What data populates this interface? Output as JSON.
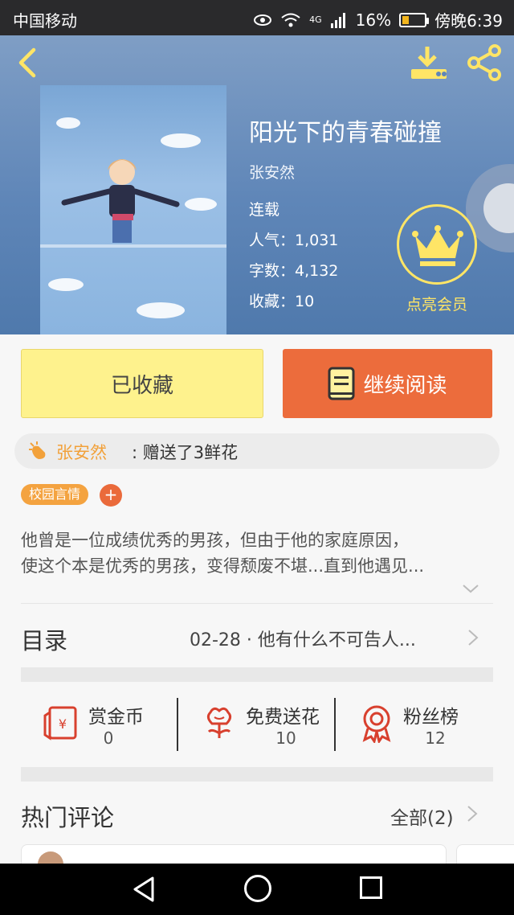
{
  "status_bar": {
    "carrier": "中国移动",
    "battery": "16%",
    "time": "傍晚6:39",
    "network": "4G"
  },
  "book": {
    "title": "阳光下的青春碰撞",
    "author": "张安然",
    "status": "连载",
    "popularity": "人气：1,031",
    "word_count": "字数：4,132",
    "favorites": "收藏：10"
  },
  "vip": {
    "label": "点亮会员"
  },
  "actions": {
    "favorited_label": "已收藏",
    "continue_label": "继续阅读"
  },
  "gift": {
    "name": "张安然",
    "text": ": 赠送了3鲜花"
  },
  "tags": [
    "校园言情"
  ],
  "tag_add": "+",
  "description": {
    "line1": "他曾是一位成绩优秀的男孩，但由于他的家庭原因，",
    "line2": "使这个本是优秀的男孩，变得颓废不堪...直到他遇见..."
  },
  "catalog": {
    "label": "目录",
    "latest": "02-28 · 他有什么不可告人..."
  },
  "stats": [
    {
      "name": "赏金币",
      "value": "0",
      "icon": "red-envelope-icon"
    },
    {
      "name": "免费送花",
      "value": "10",
      "icon": "flower-icon"
    },
    {
      "name": "粉丝榜",
      "value": "12",
      "icon": "medal-icon"
    }
  ],
  "comments": {
    "title": "热门评论",
    "all_label": "全部(2)"
  },
  "colors": {
    "accent_yellow": "#fef28d",
    "accent_orange": "#ec6c3c",
    "tag_orange": "#f4a340",
    "vip_yellow": "#ffe566",
    "icon_red": "#d8402e"
  }
}
